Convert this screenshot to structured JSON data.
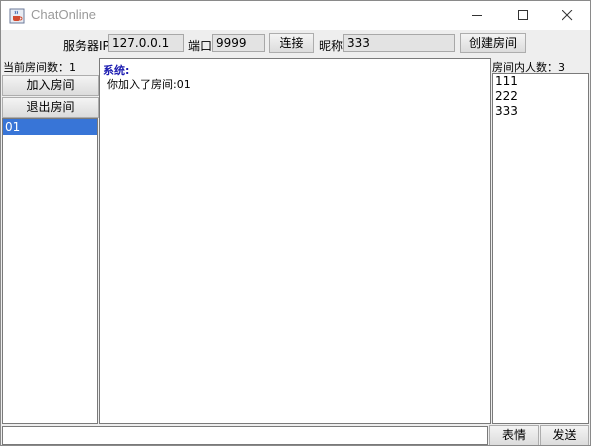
{
  "window": {
    "title": "ChatOnline"
  },
  "toolbar": {
    "server_ip_label": "服务器IP",
    "server_ip_value": "127.0.0.1",
    "port_label": "端口",
    "port_value": "9999",
    "connect_label": "连接",
    "nickname_label": "昵称",
    "nickname_value": "333",
    "create_room_label": "创建房间"
  },
  "rooms": {
    "count_text": "当前房间数：1",
    "join_label": "加入房间",
    "leave_label": "退出房间",
    "items": [
      "01"
    ],
    "selected": "01"
  },
  "chat": {
    "messages": [
      {
        "sender": "系统:",
        "text": "你加入了房间:01"
      }
    ]
  },
  "members": {
    "count_text": "房间内人数：3",
    "items": [
      "111",
      "222",
      "333"
    ]
  },
  "bottom": {
    "input_value": "",
    "emoji_label": "表情",
    "send_label": "发送"
  },
  "icons": {
    "app": "java-cup-icon",
    "minimize": "minimize-icon",
    "maximize": "maximize-icon",
    "close": "close-icon"
  },
  "colors": {
    "selection": "#3875d7",
    "system_sender": "#1b1bb0"
  }
}
